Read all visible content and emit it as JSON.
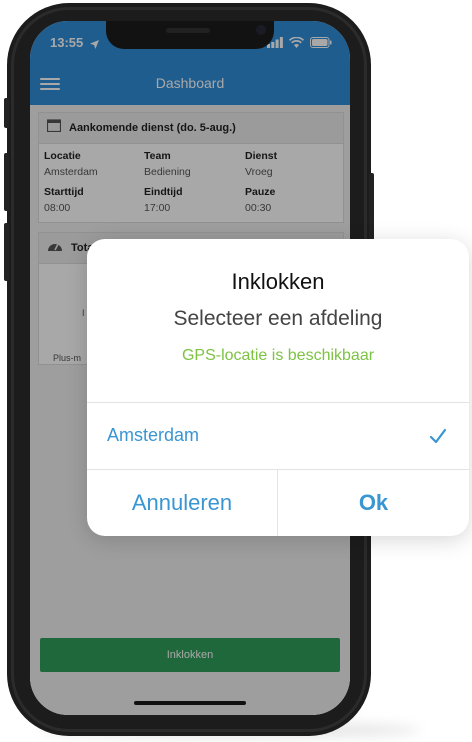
{
  "status": {
    "time": "13:55"
  },
  "navbar": {
    "title": "Dashboard"
  },
  "upcoming": {
    "title": "Aankomende dienst (do. 5-aug.)",
    "fields": [
      {
        "label": "Locatie",
        "value": "Amsterdam"
      },
      {
        "label": "Team",
        "value": "Bediening"
      },
      {
        "label": "Dienst",
        "value": "Vroeg"
      },
      {
        "label": "Starttijd",
        "value": "08:00"
      },
      {
        "label": "Eindtijd",
        "value": "17:00"
      },
      {
        "label": "Pauze",
        "value": "00:30"
      }
    ]
  },
  "totals": {
    "title_partial": "Tota",
    "fragment1": "I",
    "fragment2": "Plus-m"
  },
  "clock_in_button": "Inklokken",
  "dialog": {
    "title": "Inklokken",
    "subtitle": "Selecteer een afdeling",
    "gps_status": "GPS-locatie is beschikbaar",
    "option": "Amsterdam",
    "cancel": "Annuleren",
    "ok": "Ok"
  },
  "colors": {
    "primary_blue": "#2e8dd8",
    "success_green": "#2f9e5b",
    "gps_green": "#7dc243",
    "link_blue": "#3a95d3"
  }
}
